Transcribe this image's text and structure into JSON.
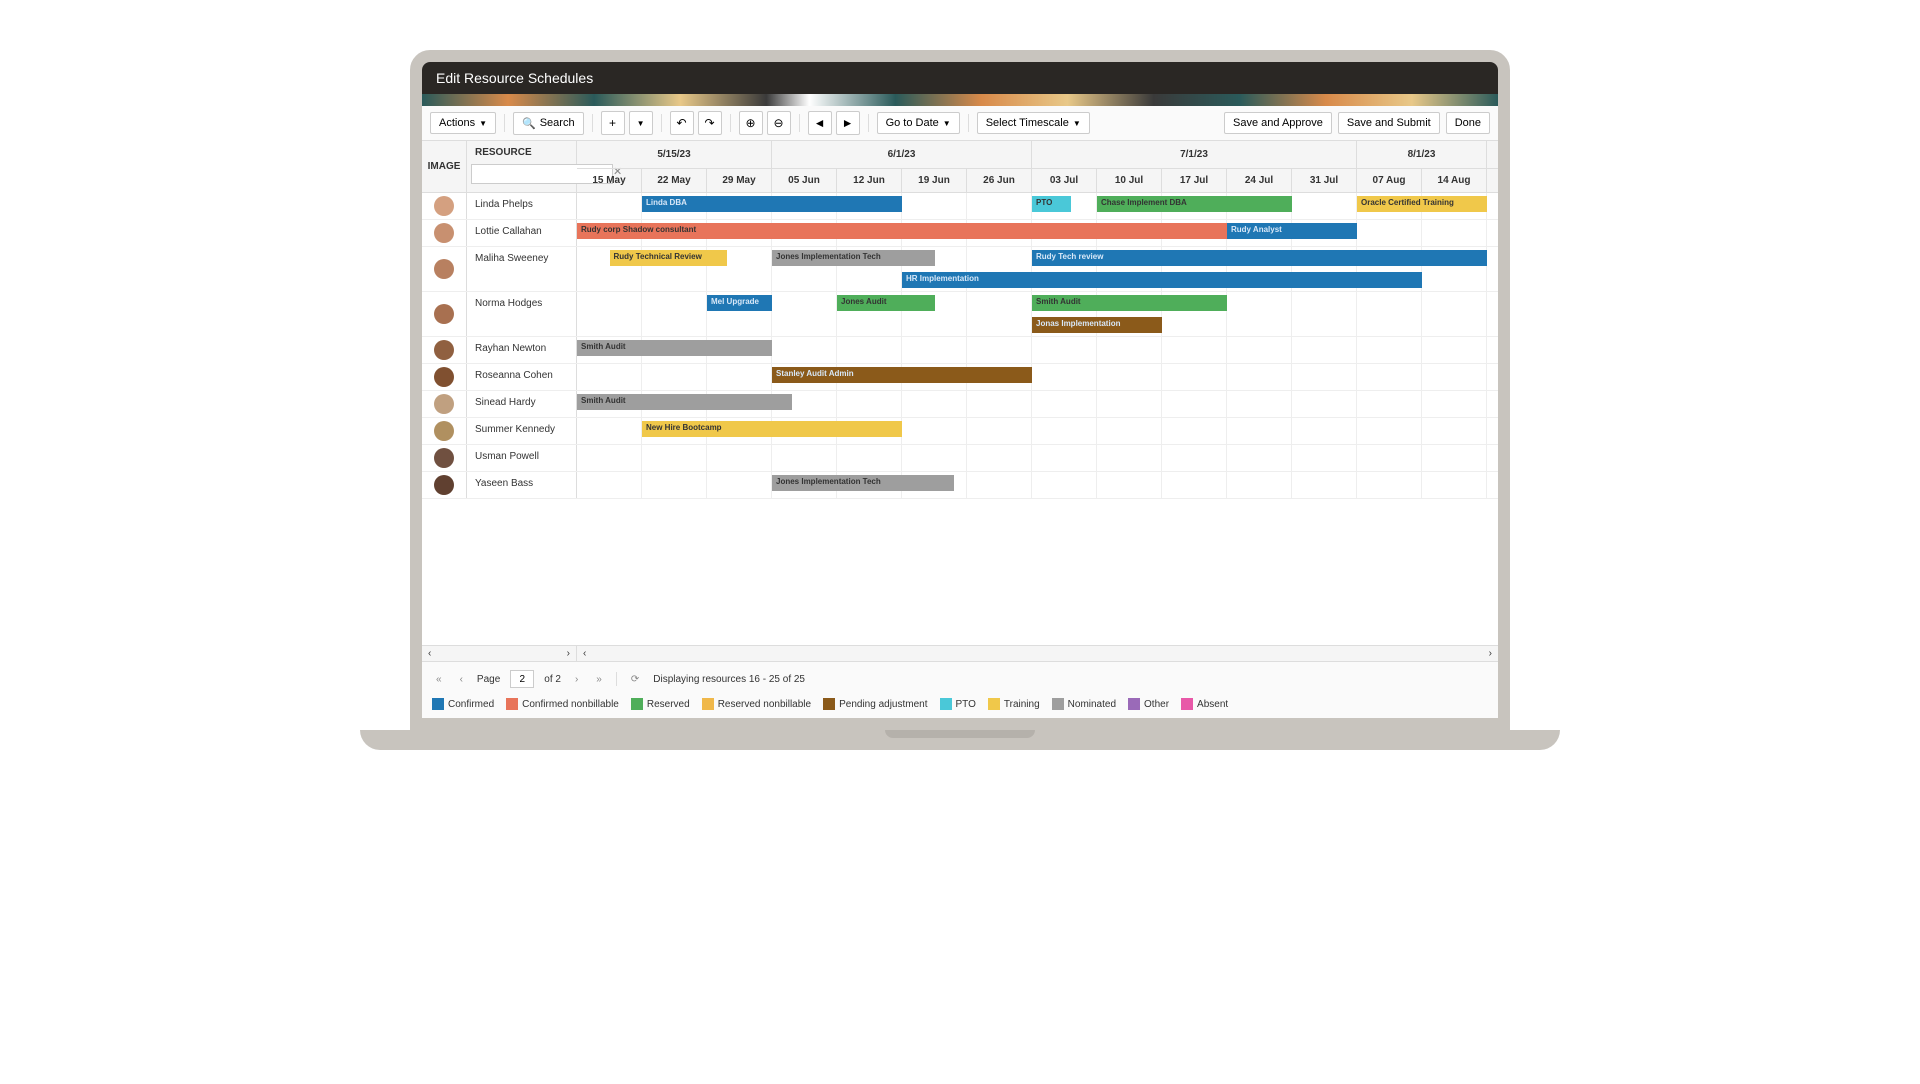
{
  "title": "Edit Resource Schedules",
  "toolbar": {
    "actions": "Actions",
    "search": "Search",
    "go_to_date": "Go to Date",
    "select_timescale": "Select Timescale",
    "save_approve": "Save and Approve",
    "save_submit": "Save and Submit",
    "done": "Done"
  },
  "headers": {
    "image": "IMAGE",
    "resource": "RESOURCE"
  },
  "months": [
    {
      "label": "5/15/23",
      "span": 3
    },
    {
      "label": "6/1/23",
      "span": 4
    },
    {
      "label": "7/1/23",
      "span": 5
    },
    {
      "label": "8/1/23",
      "span": 2
    }
  ],
  "weeks": [
    "15 May",
    "22 May",
    "29 May",
    "05 Jun",
    "12 Jun",
    "19 Jun",
    "26 Jun",
    "03 Jul",
    "10 Jul",
    "17 Jul",
    "24 Jul",
    "31 Jul",
    "07 Aug",
    "14 Aug"
  ],
  "resources": [
    {
      "name": "Linda Phelps",
      "avatar": "#d4a080",
      "bars": [
        [
          {
            "label": "Linda DBA",
            "start": 1,
            "span": 4,
            "color": "confirmed"
          },
          {
            "label": "PTO",
            "start": 7,
            "span": 0.6,
            "color": "pto"
          },
          {
            "label": "Chase Implement DBA",
            "start": 8,
            "span": 3,
            "color": "reserved"
          },
          {
            "label": "Oracle Certified Training",
            "start": 12,
            "span": 2,
            "color": "training"
          }
        ]
      ]
    },
    {
      "name": "Lottie Callahan",
      "avatar": "#c89070",
      "bars": [
        [
          {
            "label": "Rudy corp Shadow consultant",
            "start": 0,
            "span": 10,
            "color": "confirmed_nb"
          },
          {
            "label": "Rudy Analyst",
            "start": 10,
            "span": 2,
            "color": "confirmed"
          }
        ]
      ]
    },
    {
      "name": "Maliha Sweeney",
      "avatar": "#b88060",
      "bars": [
        [
          {
            "label": "Rudy Technical Review",
            "start": 0.5,
            "span": 1.8,
            "color": "training"
          },
          {
            "label": "Jones Implementation Tech",
            "start": 3,
            "span": 2.5,
            "color": "nominated"
          },
          {
            "label": "Rudy Tech review",
            "start": 7,
            "span": 7,
            "color": "confirmed"
          }
        ],
        [
          {
            "label": "HR Implementation",
            "start": 5,
            "span": 8,
            "color": "confirmed"
          }
        ]
      ]
    },
    {
      "name": "Norma Hodges",
      "avatar": "#a87050",
      "bars": [
        [
          {
            "label": "Mel Upgrade",
            "start": 2,
            "span": 1,
            "color": "confirmed"
          },
          {
            "label": "Jones Audit",
            "start": 4,
            "span": 1.5,
            "color": "reserved"
          },
          {
            "label": "Smith Audit",
            "start": 7,
            "span": 3,
            "color": "reserved"
          }
        ],
        [
          {
            "label": "Jonas Implementation",
            "start": 7,
            "span": 2,
            "color": "pending"
          }
        ]
      ]
    },
    {
      "name": "Rayhan Newton",
      "avatar": "#906040",
      "bars": [
        [
          {
            "label": "Smith Audit",
            "start": 0,
            "span": 3,
            "color": "nominated"
          }
        ]
      ]
    },
    {
      "name": "Roseanna Cohen",
      "avatar": "#805030",
      "bars": [
        [
          {
            "label": "Stanley Audit Admin",
            "start": 3,
            "span": 4,
            "color": "pending"
          }
        ]
      ]
    },
    {
      "name": "Sinead Hardy",
      "avatar": "#c0a080",
      "bars": [
        [
          {
            "label": "Smith Audit",
            "start": 0,
            "span": 3.3,
            "color": "nominated"
          }
        ]
      ]
    },
    {
      "name": "Summer Kennedy",
      "avatar": "#b09060",
      "bars": [
        [
          {
            "label": "New Hire Bootcamp",
            "start": 1,
            "span": 4,
            "color": "training"
          }
        ]
      ]
    },
    {
      "name": "Usman Powell",
      "avatar": "#705040",
      "bars": [
        []
      ]
    },
    {
      "name": "Yaseen Bass",
      "avatar": "#604030",
      "bars": [
        [
          {
            "label": "Jones Implementation Tech",
            "start": 3,
            "span": 2.8,
            "color": "nominated"
          }
        ]
      ]
    }
  ],
  "colors": {
    "confirmed": "#1f77b4",
    "confirmed_nb": "#e8745a",
    "reserved": "#4fae5a",
    "reserved_nb": "#f0b84a",
    "pending": "#8b5a1a",
    "pto": "#4ac8d8",
    "training": "#f0c84a",
    "nominated": "#9e9e9e",
    "other": "#9a6ab8",
    "absent": "#e858a8"
  },
  "legend": [
    {
      "key": "confirmed",
      "label": "Confirmed"
    },
    {
      "key": "confirmed_nb",
      "label": "Confirmed nonbillable"
    },
    {
      "key": "reserved",
      "label": "Reserved"
    },
    {
      "key": "reserved_nb",
      "label": "Reserved nonbillable"
    },
    {
      "key": "pending",
      "label": "Pending adjustment"
    },
    {
      "key": "pto",
      "label": "PTO"
    },
    {
      "key": "training",
      "label": "Training"
    },
    {
      "key": "nominated",
      "label": "Nominated"
    },
    {
      "key": "other",
      "label": "Other"
    },
    {
      "key": "absent",
      "label": "Absent"
    }
  ],
  "footer": {
    "page_label": "Page",
    "page_value": "2",
    "of_label": "of 2",
    "displaying": "Displaying resources 16 - 25 of 25"
  }
}
